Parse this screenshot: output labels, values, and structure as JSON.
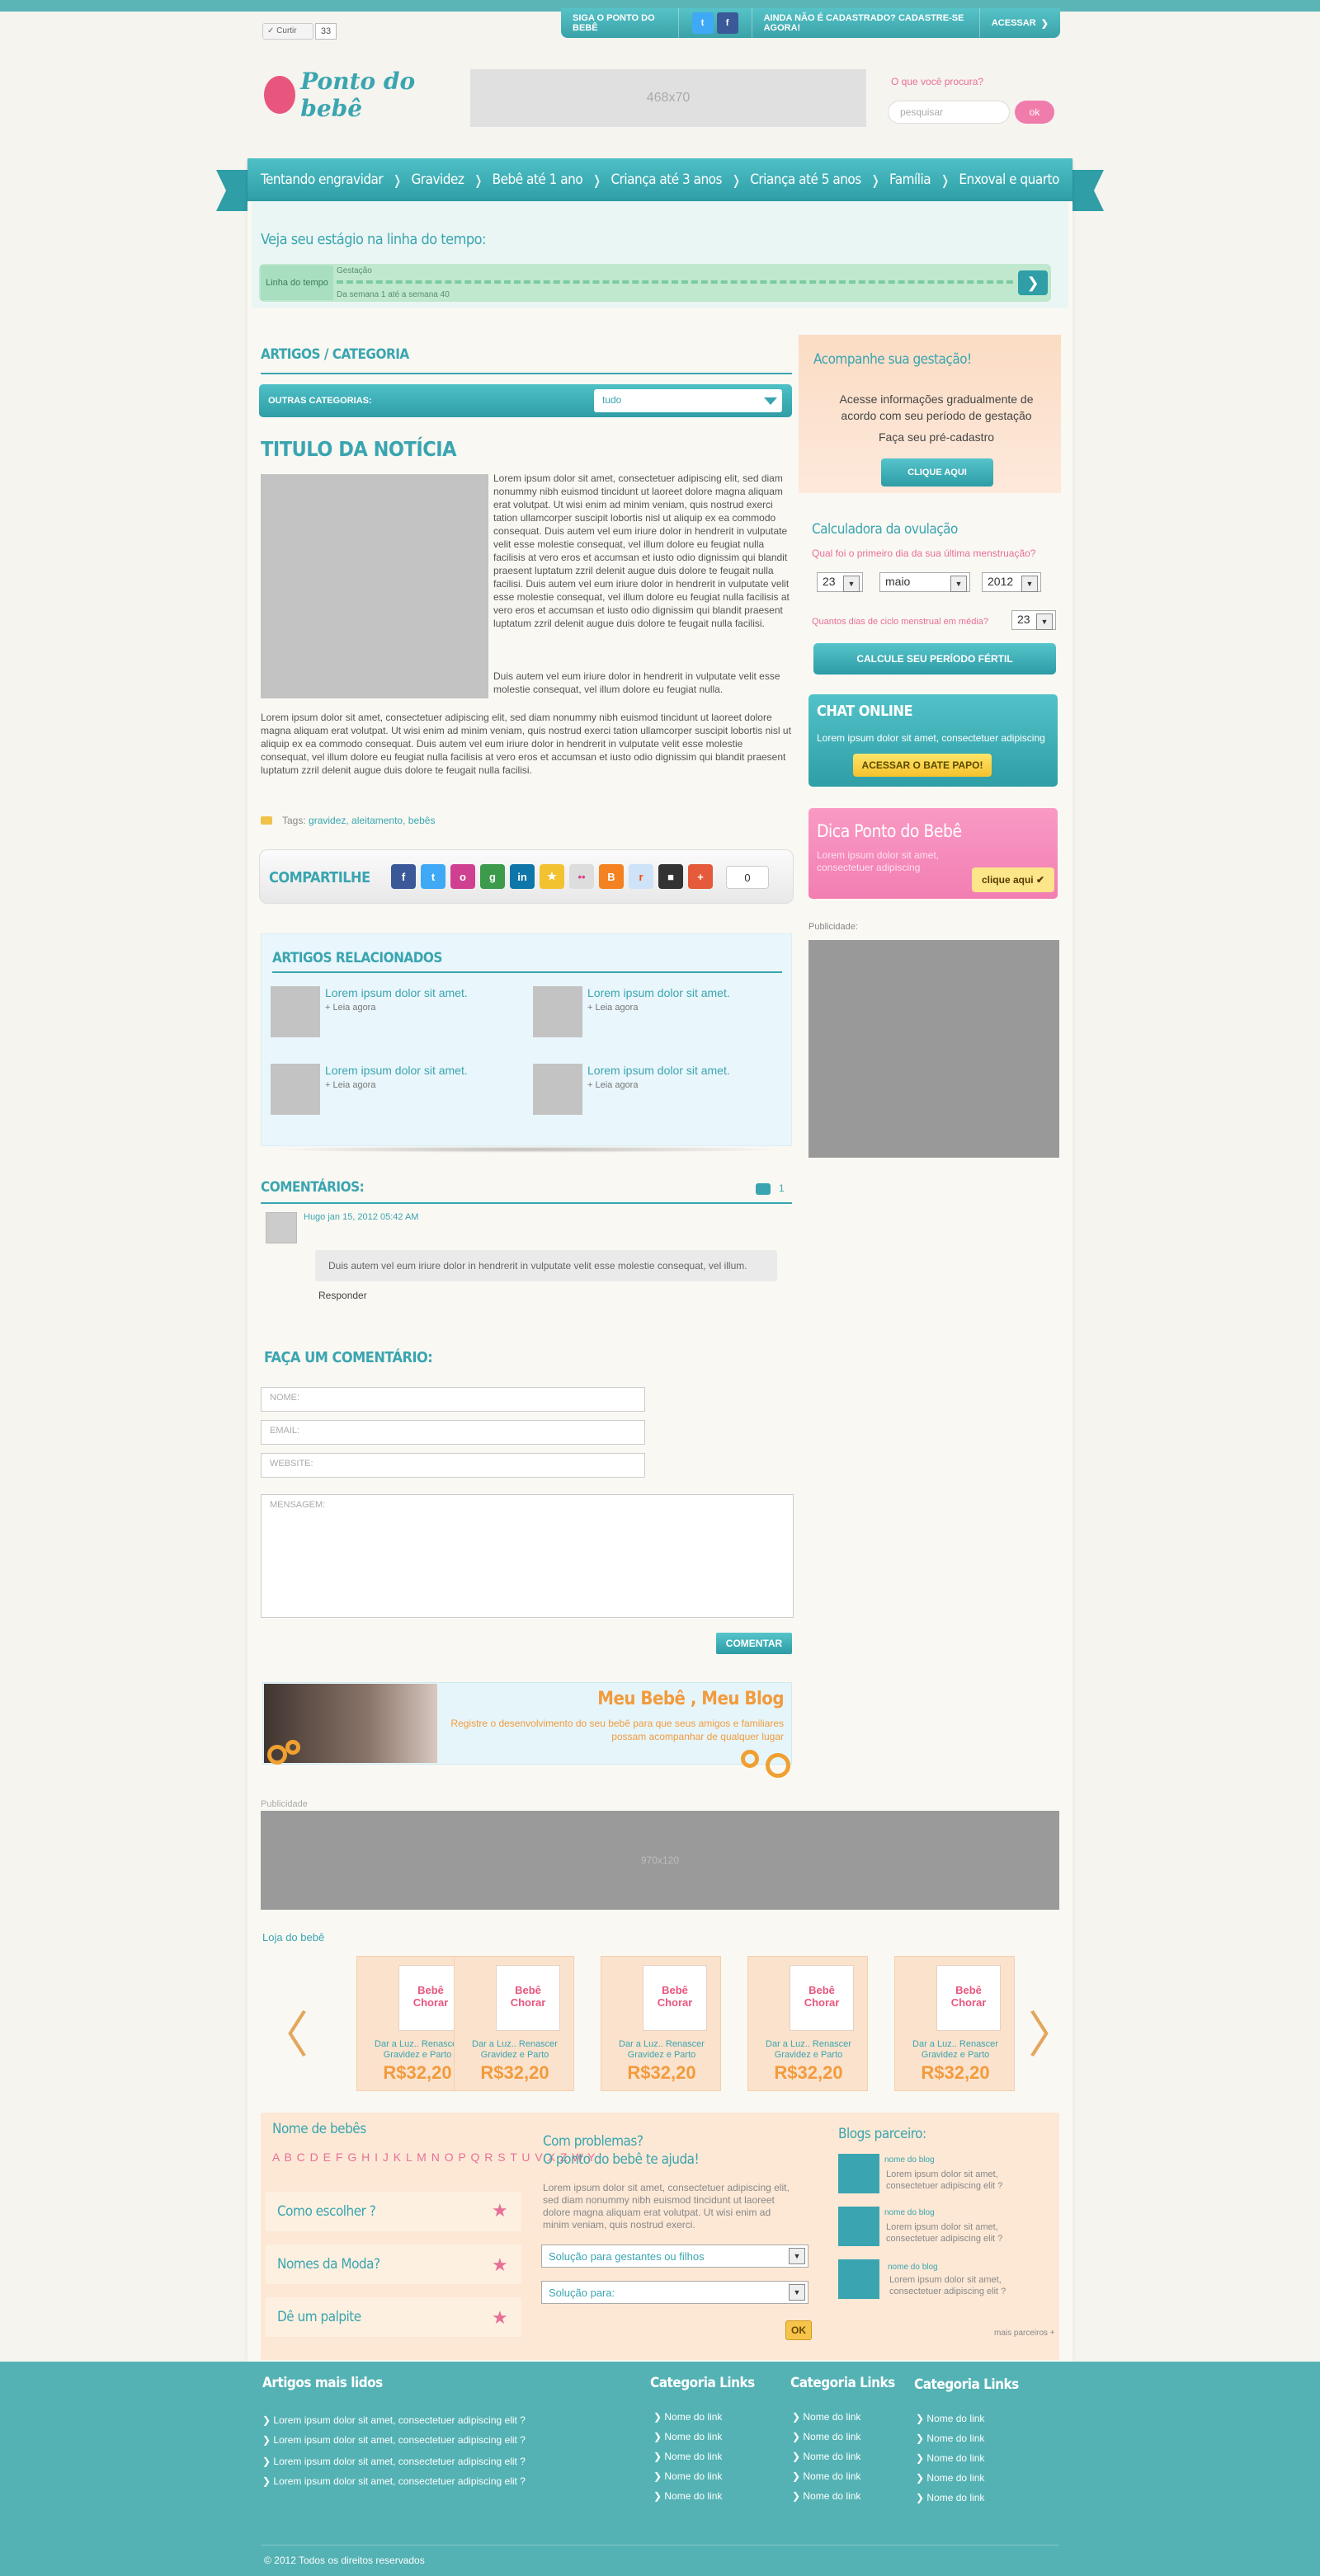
{
  "topbar": {
    "like_label": "✓ Curtir",
    "like_count": "33",
    "follow_label": "SIGA O PONTO DO BEBÊ",
    "register_label": "AINDA NÃO É CADASTRADO? CADASTRE-SE AGORA!",
    "login_label": "ACESSAR",
    "chevron": "❯"
  },
  "header": {
    "logo_text": "Ponto do bebê",
    "banner_label": "468x70",
    "search_label": "O que você procura?",
    "search_placeholder": "pesquisar",
    "search_button": "ok"
  },
  "nav": {
    "items": [
      "Tentando engravidar",
      "Gravidez",
      "Bebê até 1 ano",
      "Criança até 3 anos",
      "Criança até 5 anos",
      "Família",
      "Enxoval e quarto"
    ],
    "separator": "❭"
  },
  "timeline": {
    "title": "Veja seu estágio na linha do tempo:",
    "tag": "Linha do tempo",
    "stage": "Gestação",
    "range": "Da semana 1 até a semana 40",
    "arrow": "❯"
  },
  "article": {
    "section_title": "ARTIGOS / CATEGORIA",
    "other_categories_label": "OUTRAS CATEGORIAS:",
    "category_selected": "tudo",
    "title": "TITULO DA NOTÍCIA",
    "p1": "Lorem ipsum dolor sit amet, consectetuer adipiscing elit, sed diam nonummy nibh euismod tincidunt ut laoreet dolore magna aliquam erat volutpat. Ut wisi enim ad minim veniam, quis nostrud exerci tation ullamcorper suscipit lobortis nisl ut aliquip ex ea commodo consequat. Duis autem vel eum iriure dolor in hendrerit in vulputate velit esse molestie consequat, vel illum dolore eu feugiat nulla facilisis at vero eros et accumsan et iusto odio dignissim qui blandit praesent luptatum zzril delenit augue duis dolore te feugait nulla facilisi. Duis autem vel eum iriure dolor in hendrerit in vulputate velit esse molestie consequat, vel illum dolore eu feugiat nulla facilisis at vero eros et accumsan et iusto odio dignissim qui blandit praesent luptatum zzril delenit augue duis dolore te feugait nulla facilisi.",
    "p2": "Duis autem vel eum iriure dolor in hendrerit in vulputate velit esse molestie consequat, vel illum dolore eu feugiat nulla.",
    "p3": "Lorem ipsum dolor sit amet, consectetuer adipiscing elit, sed diam nonummy nibh euismod tincidunt ut laoreet dolore magna aliquam erat volutpat. Ut wisi enim ad minim veniam, quis nostrud exerci tation ullamcorper suscipit lobortis nisl ut aliquip ex ea commodo consequat. Duis autem vel eum iriure dolor in hendrerit in vulputate velit esse molestie consequat, vel illum dolore eu feugiat nulla facilisis at vero eros et accumsan et iusto odio dignissim qui blandit praesent luptatum zzril delenit augue duis dolore te feugait nulla facilisi.",
    "tags_label": "Tags",
    "tags_value": "gravidez, aleitamento, bebês",
    "share_label": "COMPARTILHE",
    "share_count": "0",
    "share_icons": [
      "f",
      "t",
      "o",
      "g",
      "in",
      "★",
      "••",
      "B",
      "r",
      "■",
      "+"
    ]
  },
  "related": {
    "title": "ARTIGOS RELACIONADOS",
    "items": [
      {
        "title": "Lorem ipsum dolor sit amet.",
        "more": "+ Leia agora"
      },
      {
        "title": "Lorem ipsum dolor sit amet.",
        "more": "+ Leia agora"
      },
      {
        "title": "Lorem ipsum dolor sit amet.",
        "more": "+ Leia agora"
      },
      {
        "title": "Lorem ipsum dolor sit amet.",
        "more": "+ Leia agora"
      }
    ]
  },
  "comments": {
    "title": "COMENTÁRIOS:",
    "count": "1",
    "meta": "Hugo jan 15, 2012 05:42 AM",
    "body": "Duis autem vel eum iriure dolor in hendrerit in vulputate velit esse molestie consequat, vel illum.",
    "reply": "Responder"
  },
  "form": {
    "title": "FAÇA UM COMENTÁRIO:",
    "name_placeholder": "NOME:",
    "email_placeholder": "EMAIL:",
    "website_placeholder": "WEBSITE:",
    "message_placeholder": "MENSAGEM:",
    "submit": "COMENTAR"
  },
  "baby_banner": {
    "title": "Meu Bebê , Meu Blog",
    "text": "Registre o desenvolvimento do seu bebê para que seus amigos e familiares possam acompanhar de qualquer lugar"
  },
  "ads": {
    "publicidade": "Publicidade",
    "banner970": "970x120"
  },
  "store": {
    "title": "Loja do bebê",
    "prev": "〈",
    "next": "〉",
    "products": [
      {
        "name": "Dar a Luz.. Renascer Gravidez e Parto",
        "price": "R$32,20",
        "book_title": "Bebê Chorar"
      },
      {
        "name": "Dar a Luz.. Renascer Gravidez e Parto",
        "price": "R$32,20",
        "book_title": "Bebê Chorar"
      },
      {
        "name": "Dar a Luz.. Renascer Gravidez e Parto",
        "price": "R$32,20",
        "book_title": "Bebê Chorar"
      },
      {
        "name": "Dar a Luz.. Renascer Gravidez e Parto",
        "price": "R$32,20",
        "book_title": "Bebê Chorar"
      },
      {
        "name": "Dar a Luz.. Renascer Gravidez e Parto",
        "price": "R$32,20",
        "book_title": "Bebê Chorar"
      }
    ]
  },
  "names": {
    "title": "Nome de bebês",
    "alphabet": "A B C D E F G H I J K L M N O P Q R S T U V X Z W Y",
    "items": [
      "Como escolher ?",
      "Nomes da Moda?",
      "Dê um palpite"
    ]
  },
  "problems": {
    "title_line1": "Com problemas?",
    "title_line2": "O ponto do bebê te ajuda!",
    "text": "Lorem ipsum dolor sit amet, consectetuer adipiscing elit, sed diam nonummy nibh euismod tincidunt ut laoreet dolore magna aliquam erat volutpat. Ut wisi enim ad minim veniam, quis nostrud exerci.",
    "select1": "Solução para gestantes ou filhos",
    "select2": "Solução para:",
    "ok": "OK"
  },
  "blogs": {
    "title": "Blogs parceiro:",
    "items": [
      {
        "name": "nome do blog",
        "text": "Lorem ipsum dolor sit amet, consectetuer adipiscing elit ?"
      },
      {
        "name": "nome do blog",
        "text": "Lorem ipsum dolor sit amet, consectetuer adipiscing elit ?"
      },
      {
        "name": "nome do blog",
        "text": "Lorem ipsum dolor sit amet, consectetuer adipiscing elit ?"
      }
    ],
    "more": "mais parceiros +"
  },
  "sidebar": {
    "gest_title": "Acompanhe sua gestação!",
    "gest_text": "Acesse informações gradualmente de acordo com seu período de gestação",
    "gest_sub": "Faça seu pré-cadastro",
    "gest_btn": "CLIQUE AQUI",
    "calc_title": "Calculadora da ovulação",
    "calc_q1": "Qual foi o primeiro dia da sua última menstruação?",
    "day": "23",
    "month": "maio",
    "year": "2012",
    "calc_q2": "Quantos dias de ciclo menstrual em média?",
    "cycle": "23",
    "calc_btn": "CALCULE SEU PERÍODO FÉRTIL",
    "chat_title": "CHAT ONLINE",
    "chat_text": "Lorem ipsum dolor sit amet, consectetuer adipiscing",
    "chat_btn": "ACESSAR O BATE PAPO!",
    "tip_title": "Dica Ponto do Bebê",
    "tip_text": "Lorem ipsum dolor sit amet, consectetuer adipiscing",
    "tip_btn": "clique aqui ✔",
    "pub_label": "Publicidade:"
  },
  "footer": {
    "most_read_title": "Artigos mais lidos",
    "most_read": [
      "Lorem ipsum dolor sit amet, consectetuer adipiscing elit ?",
      "Lorem ipsum dolor sit amet, consectetuer adipiscing elit ?",
      "Lorem ipsum dolor sit amet, consectetuer adipiscing elit ?",
      "Lorem ipsum dolor sit amet, consectetuer adipiscing elit ?"
    ],
    "columns": [
      {
        "title": "Categoria Links",
        "links": [
          "Nome do link",
          "Nome do link",
          "Nome do link",
          "Nome do link",
          "Nome do link"
        ]
      },
      {
        "title": "Categoria Links",
        "links": [
          "Nome do link",
          "Nome do link",
          "Nome do link",
          "Nome do link",
          "Nome do link"
        ]
      },
      {
        "title": "Categoria Links",
        "links": [
          "Nome do link",
          "Nome do link",
          "Nome do link",
          "Nome do link",
          "Nome do link"
        ]
      }
    ],
    "copyright": "© 2012 Todos os direitos reservados"
  },
  "colors": {
    "accent": "#3aa5b0",
    "pink": "#e86f98",
    "orange": "#f29b3e"
  }
}
